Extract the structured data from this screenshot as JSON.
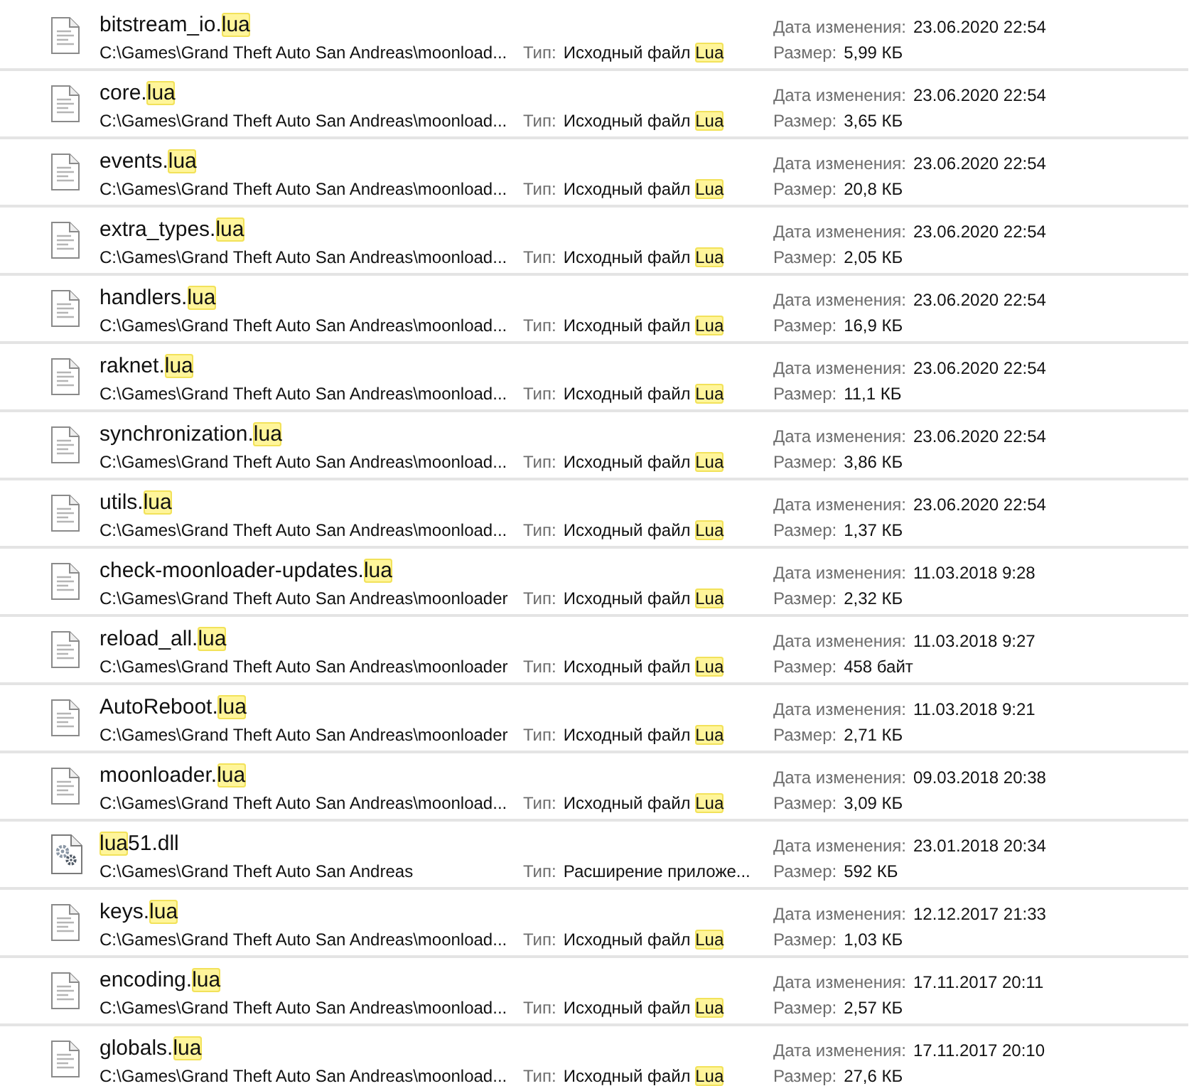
{
  "results": [
    {
      "kind": "document",
      "name": [
        {
          "text": "bitstream_io.",
          "highlighted": false
        },
        {
          "text": "lua",
          "highlighted": true
        }
      ],
      "path": "C:\\Games\\Grand Theft Auto San Andreas\\moonload...",
      "type_label": "Тип:",
      "type": [
        {
          "text": "Исходный файл ",
          "highlighted": false
        },
        {
          "text": "Lua",
          "highlighted": true
        }
      ],
      "date_label": "Дата изменения:",
      "date": "23.06.2020 22:54",
      "size_label": "Размер:",
      "size": "5,99 КБ"
    },
    {
      "kind": "document",
      "name": [
        {
          "text": "core.",
          "highlighted": false
        },
        {
          "text": "lua",
          "highlighted": true
        }
      ],
      "path": "C:\\Games\\Grand Theft Auto San Andreas\\moonload...",
      "type_label": "Тип:",
      "type": [
        {
          "text": "Исходный файл ",
          "highlighted": false
        },
        {
          "text": "Lua",
          "highlighted": true
        }
      ],
      "date_label": "Дата изменения:",
      "date": "23.06.2020 22:54",
      "size_label": "Размер:",
      "size": "3,65 КБ"
    },
    {
      "kind": "document",
      "name": [
        {
          "text": "events.",
          "highlighted": false
        },
        {
          "text": "lua",
          "highlighted": true
        }
      ],
      "path": "C:\\Games\\Grand Theft Auto San Andreas\\moonload...",
      "type_label": "Тип:",
      "type": [
        {
          "text": "Исходный файл ",
          "highlighted": false
        },
        {
          "text": "Lua",
          "highlighted": true
        }
      ],
      "date_label": "Дата изменения:",
      "date": "23.06.2020 22:54",
      "size_label": "Размер:",
      "size": "20,8 КБ"
    },
    {
      "kind": "document",
      "name": [
        {
          "text": "extra_types.",
          "highlighted": false
        },
        {
          "text": "lua",
          "highlighted": true
        }
      ],
      "path": "C:\\Games\\Grand Theft Auto San Andreas\\moonload...",
      "type_label": "Тип:",
      "type": [
        {
          "text": "Исходный файл ",
          "highlighted": false
        },
        {
          "text": "Lua",
          "highlighted": true
        }
      ],
      "date_label": "Дата изменения:",
      "date": "23.06.2020 22:54",
      "size_label": "Размер:",
      "size": "2,05 КБ"
    },
    {
      "kind": "document",
      "name": [
        {
          "text": "handlers.",
          "highlighted": false
        },
        {
          "text": "lua",
          "highlighted": true
        }
      ],
      "path": "C:\\Games\\Grand Theft Auto San Andreas\\moonload...",
      "type_label": "Тип:",
      "type": [
        {
          "text": "Исходный файл ",
          "highlighted": false
        },
        {
          "text": "Lua",
          "highlighted": true
        }
      ],
      "date_label": "Дата изменения:",
      "date": "23.06.2020 22:54",
      "size_label": "Размер:",
      "size": "16,9 КБ"
    },
    {
      "kind": "document",
      "name": [
        {
          "text": "raknet.",
          "highlighted": false
        },
        {
          "text": "lua",
          "highlighted": true
        }
      ],
      "path": "C:\\Games\\Grand Theft Auto San Andreas\\moonload...",
      "type_label": "Тип:",
      "type": [
        {
          "text": "Исходный файл ",
          "highlighted": false
        },
        {
          "text": "Lua",
          "highlighted": true
        }
      ],
      "date_label": "Дата изменения:",
      "date": "23.06.2020 22:54",
      "size_label": "Размер:",
      "size": "11,1 КБ"
    },
    {
      "kind": "document",
      "name": [
        {
          "text": "synchronization.",
          "highlighted": false
        },
        {
          "text": "lua",
          "highlighted": true
        }
      ],
      "path": "C:\\Games\\Grand Theft Auto San Andreas\\moonload...",
      "type_label": "Тип:",
      "type": [
        {
          "text": "Исходный файл ",
          "highlighted": false
        },
        {
          "text": "Lua",
          "highlighted": true
        }
      ],
      "date_label": "Дата изменения:",
      "date": "23.06.2020 22:54",
      "size_label": "Размер:",
      "size": "3,86 КБ"
    },
    {
      "kind": "document",
      "name": [
        {
          "text": "utils.",
          "highlighted": false
        },
        {
          "text": "lua",
          "highlighted": true
        }
      ],
      "path": "C:\\Games\\Grand Theft Auto San Andreas\\moonload...",
      "type_label": "Тип:",
      "type": [
        {
          "text": "Исходный файл ",
          "highlighted": false
        },
        {
          "text": "Lua",
          "highlighted": true
        }
      ],
      "date_label": "Дата изменения:",
      "date": "23.06.2020 22:54",
      "size_label": "Размер:",
      "size": "1,37 КБ"
    },
    {
      "kind": "document",
      "name": [
        {
          "text": "check-moonloader-updates.",
          "highlighted": false
        },
        {
          "text": "lua",
          "highlighted": true
        }
      ],
      "path": "C:\\Games\\Grand Theft Auto San Andreas\\moonloader",
      "type_label": "Тип:",
      "type": [
        {
          "text": "Исходный файл ",
          "highlighted": false
        },
        {
          "text": "Lua",
          "highlighted": true
        }
      ],
      "date_label": "Дата изменения:",
      "date": "11.03.2018 9:28",
      "size_label": "Размер:",
      "size": "2,32 КБ"
    },
    {
      "kind": "document",
      "name": [
        {
          "text": "reload_all.",
          "highlighted": false
        },
        {
          "text": "lua",
          "highlighted": true
        }
      ],
      "path": "C:\\Games\\Grand Theft Auto San Andreas\\moonloader",
      "type_label": "Тип:",
      "type": [
        {
          "text": "Исходный файл ",
          "highlighted": false
        },
        {
          "text": "Lua",
          "highlighted": true
        }
      ],
      "date_label": "Дата изменения:",
      "date": "11.03.2018 9:27",
      "size_label": "Размер:",
      "size": "458 байт"
    },
    {
      "kind": "document",
      "name": [
        {
          "text": "AutoReboot.",
          "highlighted": false
        },
        {
          "text": "lua",
          "highlighted": true
        }
      ],
      "path": "C:\\Games\\Grand Theft Auto San Andreas\\moonloader",
      "type_label": "Тип:",
      "type": [
        {
          "text": "Исходный файл ",
          "highlighted": false
        },
        {
          "text": "Lua",
          "highlighted": true
        }
      ],
      "date_label": "Дата изменения:",
      "date": "11.03.2018 9:21",
      "size_label": "Размер:",
      "size": "2,71 КБ"
    },
    {
      "kind": "document",
      "name": [
        {
          "text": "moonloader.",
          "highlighted": false
        },
        {
          "text": "lua",
          "highlighted": true
        }
      ],
      "path": "C:\\Games\\Grand Theft Auto San Andreas\\moonload...",
      "type_label": "Тип:",
      "type": [
        {
          "text": "Исходный файл ",
          "highlighted": false
        },
        {
          "text": "Lua",
          "highlighted": true
        }
      ],
      "date_label": "Дата изменения:",
      "date": "09.03.2018 20:38",
      "size_label": "Размер:",
      "size": "3,09 КБ"
    },
    {
      "kind": "library",
      "name": [
        {
          "text": "lua",
          "highlighted": true
        },
        {
          "text": "51.dll",
          "highlighted": false
        }
      ],
      "path": "C:\\Games\\Grand Theft Auto San Andreas",
      "type_label": "Тип:",
      "type": [
        {
          "text": "Расширение приложе...",
          "highlighted": false
        }
      ],
      "date_label": "Дата изменения:",
      "date": "23.01.2018 20:34",
      "size_label": "Размер:",
      "size": "592 КБ"
    },
    {
      "kind": "document",
      "name": [
        {
          "text": "keys.",
          "highlighted": false
        },
        {
          "text": "lua",
          "highlighted": true
        }
      ],
      "path": "C:\\Games\\Grand Theft Auto San Andreas\\moonload...",
      "type_label": "Тип:",
      "type": [
        {
          "text": "Исходный файл ",
          "highlighted": false
        },
        {
          "text": "Lua",
          "highlighted": true
        }
      ],
      "date_label": "Дата изменения:",
      "date": "12.12.2017 21:33",
      "size_label": "Размер:",
      "size": "1,03 КБ"
    },
    {
      "kind": "document",
      "name": [
        {
          "text": "encoding.",
          "highlighted": false
        },
        {
          "text": "lua",
          "highlighted": true
        }
      ],
      "path": "C:\\Games\\Grand Theft Auto San Andreas\\moonload...",
      "type_label": "Тип:",
      "type": [
        {
          "text": "Исходный файл ",
          "highlighted": false
        },
        {
          "text": "Lua",
          "highlighted": true
        }
      ],
      "date_label": "Дата изменения:",
      "date": "17.11.2017 20:11",
      "size_label": "Размер:",
      "size": "2,57 КБ"
    },
    {
      "kind": "document",
      "name": [
        {
          "text": "globals.",
          "highlighted": false
        },
        {
          "text": "lua",
          "highlighted": true
        }
      ],
      "path": "C:\\Games\\Grand Theft Auto San Andreas\\moonload...",
      "type_label": "Тип:",
      "type": [
        {
          "text": "Исходный файл ",
          "highlighted": false
        },
        {
          "text": "Lua",
          "highlighted": true
        }
      ],
      "date_label": "Дата изменения:",
      "date": "17.11.2017 20:10",
      "size_label": "Размер:",
      "size": "27,6 КБ"
    }
  ]
}
